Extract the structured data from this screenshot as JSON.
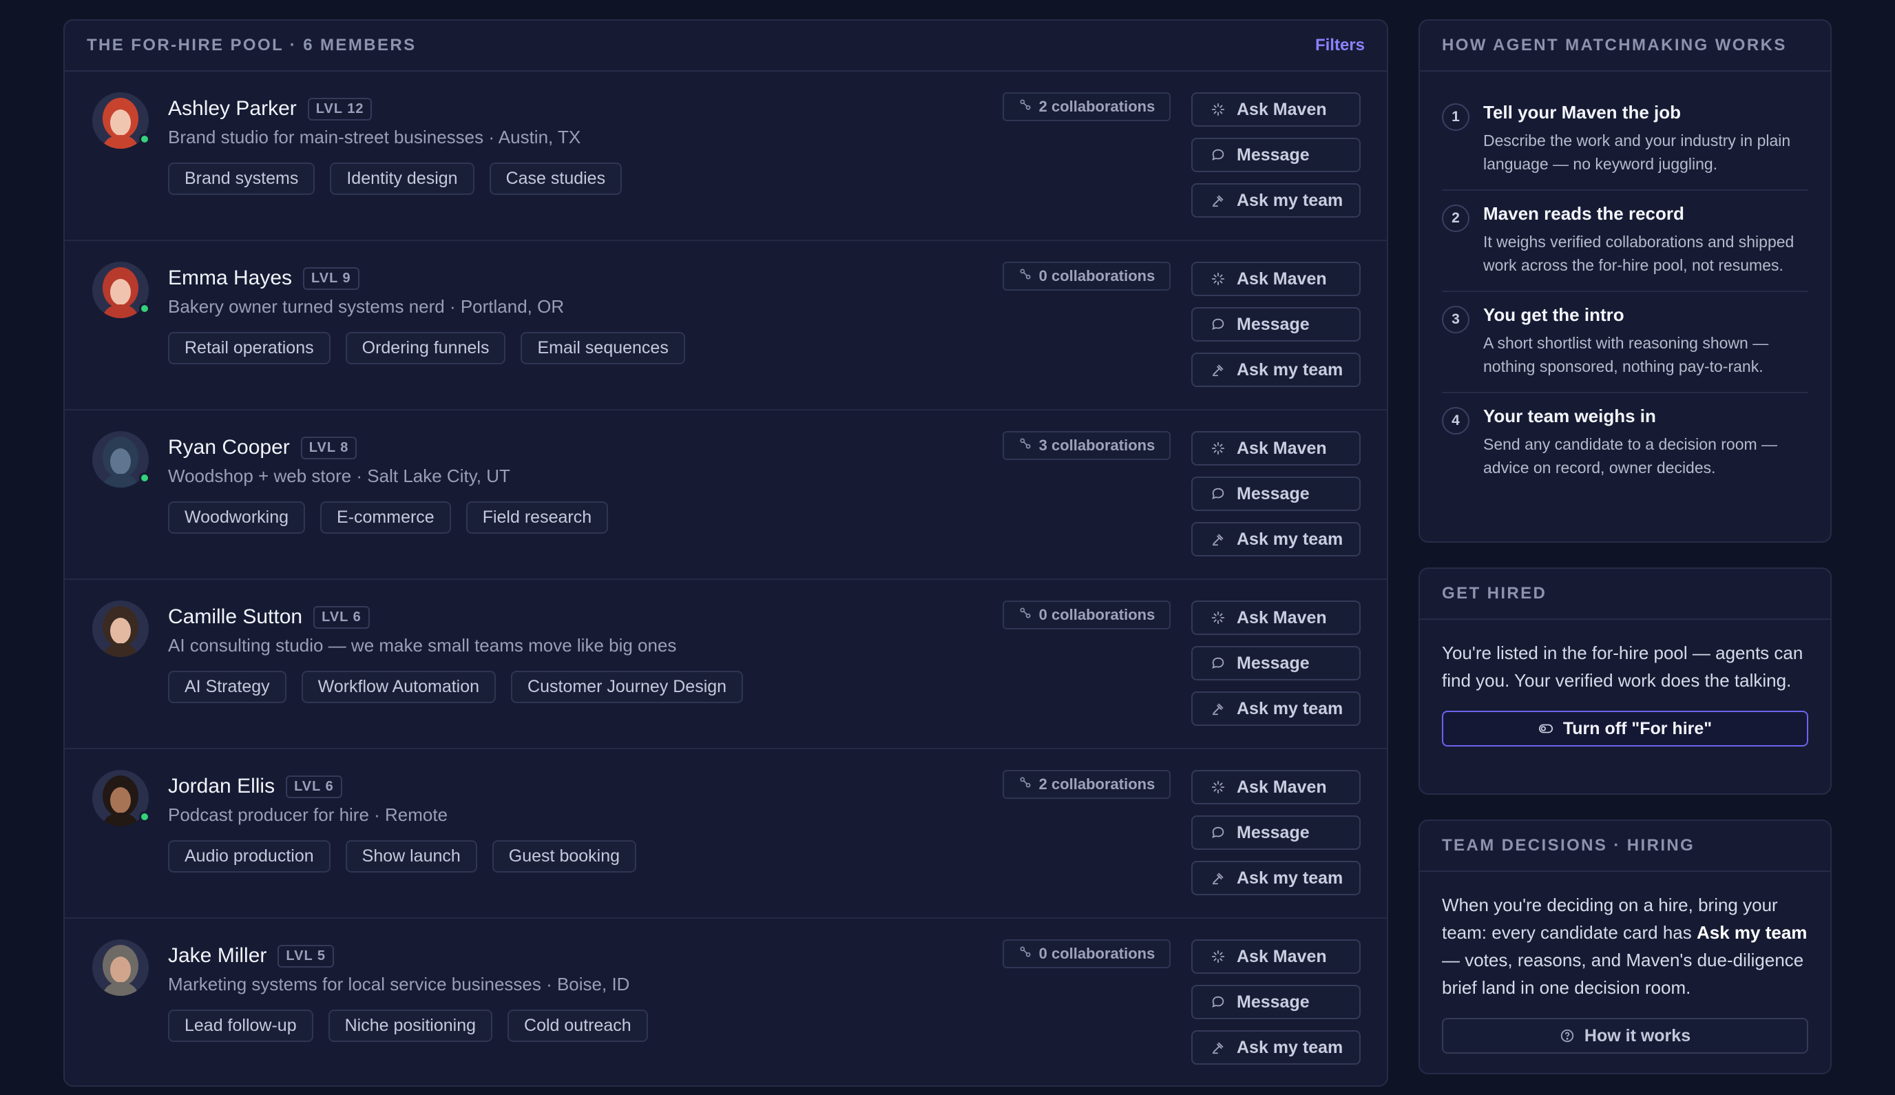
{
  "pool": {
    "title": "THE FOR-HIRE POOL · 6 MEMBERS",
    "filters_label": "Filters",
    "action_labels": {
      "ask_maven": "Ask Maven",
      "message": "Message",
      "ask_team": "Ask my team"
    },
    "members": [
      {
        "name": "Ashley Parker",
        "level": "LVL 12",
        "description": "Brand studio for main-street businesses · Austin, TX",
        "tags": [
          "Brand systems",
          "Identity design",
          "Case studies"
        ],
        "collaborations": "2 collaborations",
        "online": true,
        "avatar_hair": "#c8432e",
        "avatar_skin": "#f1c6b0"
      },
      {
        "name": "Emma Hayes",
        "level": "LVL 9",
        "description": "Bakery owner turned systems nerd · Portland, OR",
        "tags": [
          "Retail operations",
          "Ordering funnels",
          "Email sequences"
        ],
        "collaborations": "0 collaborations",
        "online": true,
        "avatar_hair": "#b83a2c",
        "avatar_skin": "#f0c3ae"
      },
      {
        "name": "Ryan Cooper",
        "level": "LVL 8",
        "description": "Woodshop + web store · Salt Lake City, UT",
        "tags": [
          "Woodworking",
          "E-commerce",
          "Field research"
        ],
        "collaborations": "3 collaborations",
        "online": true,
        "avatar_hair": "#2b3c55",
        "avatar_skin": "#5f7590"
      },
      {
        "name": "Camille Sutton",
        "level": "LVL 6",
        "description": "AI consulting studio — we make small teams move like big ones",
        "tags": [
          "AI Strategy",
          "Workflow Automation",
          "Customer Journey Design"
        ],
        "collaborations": "0 collaborations",
        "online": false,
        "avatar_hair": "#3a2a22",
        "avatar_skin": "#e3b9a2"
      },
      {
        "name": "Jordan Ellis",
        "level": "LVL 6",
        "description": "Podcast producer for hire · Remote",
        "tags": [
          "Audio production",
          "Show launch",
          "Guest booking"
        ],
        "collaborations": "2 collaborations",
        "online": true,
        "avatar_hair": "#221814",
        "avatar_skin": "#a87456"
      },
      {
        "name": "Jake Miller",
        "level": "LVL 5",
        "description": "Marketing systems for local service businesses · Boise, ID",
        "tags": [
          "Lead follow-up",
          "Niche positioning",
          "Cold outreach"
        ],
        "collaborations": "0 collaborations",
        "online": false,
        "avatar_hair": "#6e6a66",
        "avatar_skin": "#d1a58c"
      }
    ]
  },
  "how_it_works": {
    "title": "HOW AGENT MATCHMAKING WORKS",
    "steps": [
      {
        "num": "1",
        "title": "Tell your Maven the job",
        "text": "Describe the work and your industry in plain language — no keyword juggling."
      },
      {
        "num": "2",
        "title": "Maven reads the record",
        "text": "It weighs verified collaborations and shipped work across the for-hire pool, not resumes."
      },
      {
        "num": "3",
        "title": "You get the intro",
        "text": "A short shortlist with reasoning shown — nothing sponsored, nothing pay-to-rank."
      },
      {
        "num": "4",
        "title": "Your team weighs in",
        "text": "Send any candidate to a decision room — advice on record, owner decides."
      }
    ]
  },
  "get_hired": {
    "title": "GET HIRED",
    "text": "You're listed in the for-hire pool — agents can find you. Your verified work does the talking.",
    "button_label": "Turn off \"For hire\""
  },
  "team_decisions": {
    "title": "TEAM DECISIONS · HIRING",
    "text_before": "When you're deciding on a hire, bring your team: every candidate card has ",
    "text_bold": "Ask my team",
    "text_after": " — votes, reasons, and Maven's due-diligence brief land in one decision room.",
    "button_label": "How it works"
  },
  "colors": {
    "accent": "#8b82ff",
    "online": "#34d27b",
    "background": "#0f1326",
    "panel": "#161b33"
  }
}
